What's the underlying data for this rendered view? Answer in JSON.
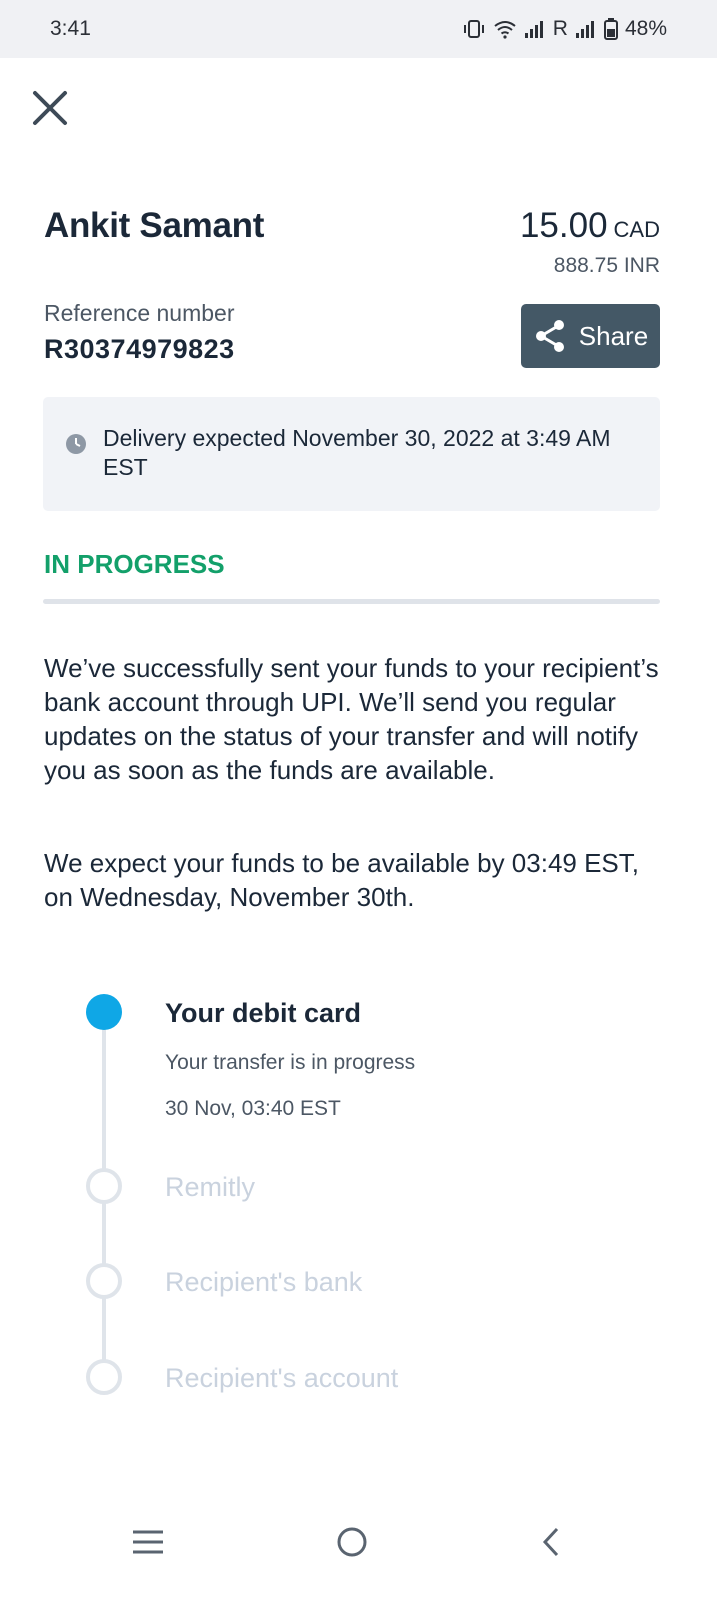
{
  "status_bar": {
    "time": "3:41",
    "roaming_label": "R",
    "battery": "48%"
  },
  "transfer": {
    "recipient_name": "Ankit Samant",
    "amount": "15.00",
    "currency": "CAD",
    "converted_amount": "888.75 INR",
    "reference_label": "Reference number",
    "reference_number": "R30374979823",
    "share_label": "Share",
    "delivery_text": "Delivery expected November 30, 2022 at 3:49 AM EST",
    "status": "IN PROGRESS",
    "message_1": "We’ve successfully sent your funds to your recipient’s bank account through UPI. We’ll send you regular updates on the status of your transfer and will notify you as soon as the funds are available.",
    "message_2": "We expect your funds to be available by 03:49 EST, on Wednesday, November 30th."
  },
  "timeline": [
    {
      "title": "Your debit card",
      "detail": "Your transfer is in progress",
      "timestamp": "30 Nov, 03:40 EST",
      "state": "active"
    },
    {
      "title": "Remitly",
      "state": "pending"
    },
    {
      "title": "Recipient's bank",
      "state": "pending"
    },
    {
      "title": "Recipient's account",
      "state": "pending"
    }
  ],
  "icons": {
    "close": "close-icon",
    "share": "share-icon",
    "clock": "clock-icon",
    "nav_recents": "recents-icon",
    "nav_home": "home-icon",
    "nav_back": "back-icon"
  },
  "colors": {
    "status_in_progress": "#13a06a",
    "share_button": "#445866",
    "timeline_active": "#0fa7e6",
    "timeline_pending": "#dfe4ea"
  }
}
